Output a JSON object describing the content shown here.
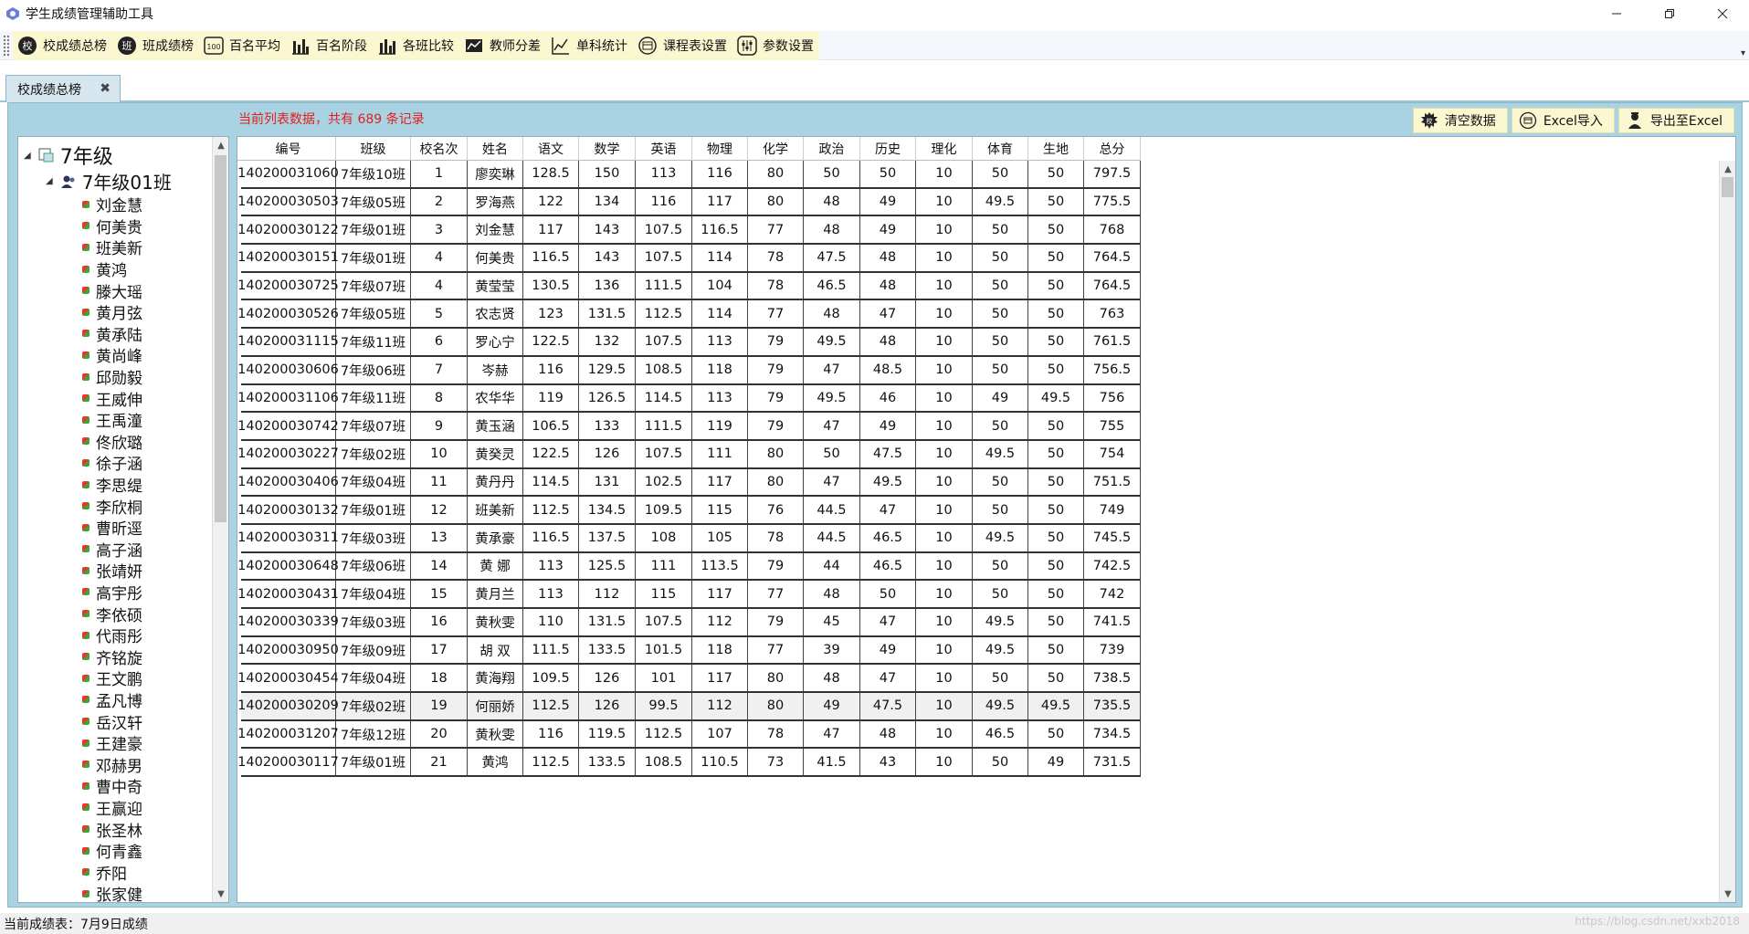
{
  "window": {
    "title": "学生成绩管理辅助工具"
  },
  "toolbar": {
    "buttons": [
      {
        "label": "校成绩总榜",
        "icon": "school-badge-icon"
      },
      {
        "label": "班成绩榜",
        "icon": "class-badge-icon"
      },
      {
        "label": "百名平均",
        "icon": "hundred-icon"
      },
      {
        "label": "百名阶段",
        "icon": "bar-chart-icon"
      },
      {
        "label": "各班比较",
        "icon": "bar-chart-icon"
      },
      {
        "label": "教师分差",
        "icon": "teacher-chart-icon"
      },
      {
        "label": "单科统计",
        "icon": "line-chart-icon"
      },
      {
        "label": "课程表设置",
        "icon": "schedule-icon"
      },
      {
        "label": "参数设置",
        "icon": "sliders-icon"
      }
    ]
  },
  "tab": {
    "label": "校成绩总榜"
  },
  "panel": {
    "info": "当前列表数据，共有 689 条记录",
    "actions": [
      {
        "label": "清空数据",
        "icon": "clear-icon"
      },
      {
        "label": "Excel导入",
        "icon": "import-icon"
      },
      {
        "label": "导出至Excel",
        "icon": "export-icon"
      }
    ]
  },
  "tree": {
    "root": "7年级",
    "class": "7年级01班",
    "students": [
      "刘金慧",
      "何美贵",
      "班美新",
      "黄鸿",
      "滕大瑶",
      "黄月弦",
      "黄承陆",
      "黄尚峰",
      "邱勋毅",
      "王威伸",
      "王禹潼",
      "佟欣璐",
      "徐子涵",
      "李思缇",
      "李欣桐",
      "曹昕逕",
      "高子涵",
      "张靖妍",
      "高宇彤",
      "李依硕",
      "代雨彤",
      "齐铭旋",
      "王文鹏",
      "孟凡博",
      "岳汉轩",
      "王建豪",
      "邓赫男",
      "曹中奇",
      "王赢迎",
      "张圣林",
      "何青鑫",
      "乔阳",
      "张家健"
    ]
  },
  "grid": {
    "columns": [
      "编号",
      "班级",
      "校名次",
      "姓名",
      "语文",
      "数学",
      "英语",
      "物理",
      "化学",
      "政治",
      "历史",
      "理化",
      "体育",
      "生地",
      "总分"
    ],
    "rows": [
      [
        "140200031060",
        "7年级10班",
        "1",
        "廖奕琳",
        "128.5",
        "150",
        "113",
        "116",
        "80",
        "50",
        "50",
        "10",
        "50",
        "50",
        "797.5"
      ],
      [
        "140200030503",
        "7年级05班",
        "2",
        "罗海燕",
        "122",
        "134",
        "116",
        "117",
        "80",
        "48",
        "49",
        "10",
        "49.5",
        "50",
        "775.5"
      ],
      [
        "140200030122",
        "7年级01班",
        "3",
        "刘金慧",
        "117",
        "143",
        "107.5",
        "116.5",
        "77",
        "48",
        "49",
        "10",
        "50",
        "50",
        "768"
      ],
      [
        "140200030151",
        "7年级01班",
        "4",
        "何美贵",
        "116.5",
        "143",
        "107.5",
        "114",
        "78",
        "47.5",
        "48",
        "10",
        "50",
        "50",
        "764.5"
      ],
      [
        "140200030725",
        "7年级07班",
        "4",
        "黄莹莹",
        "130.5",
        "136",
        "111.5",
        "104",
        "78",
        "46.5",
        "48",
        "10",
        "50",
        "50",
        "764.5"
      ],
      [
        "140200030526",
        "7年级05班",
        "5",
        "农志贤",
        "123",
        "131.5",
        "112.5",
        "114",
        "77",
        "48",
        "47",
        "10",
        "50",
        "50",
        "763"
      ],
      [
        "140200031115",
        "7年级11班",
        "6",
        "罗心宁",
        "122.5",
        "132",
        "107.5",
        "113",
        "79",
        "49.5",
        "48",
        "10",
        "50",
        "50",
        "761.5"
      ],
      [
        "140200030606",
        "7年级06班",
        "7",
        "岑赫",
        "116",
        "129.5",
        "108.5",
        "118",
        "79",
        "47",
        "48.5",
        "10",
        "50",
        "50",
        "756.5"
      ],
      [
        "140200031106",
        "7年级11班",
        "8",
        "农华华",
        "119",
        "126.5",
        "114.5",
        "113",
        "79",
        "49.5",
        "46",
        "10",
        "49",
        "49.5",
        "756"
      ],
      [
        "140200030742",
        "7年级07班",
        "9",
        "黄玉涵",
        "106.5",
        "133",
        "111.5",
        "119",
        "79",
        "47",
        "49",
        "10",
        "50",
        "50",
        "755"
      ],
      [
        "140200030227",
        "7年级02班",
        "10",
        "黄癸灵",
        "122.5",
        "126",
        "107.5",
        "111",
        "80",
        "50",
        "47.5",
        "10",
        "49.5",
        "50",
        "754"
      ],
      [
        "140200030406",
        "7年级04班",
        "11",
        "黄丹丹",
        "114.5",
        "131",
        "102.5",
        "117",
        "80",
        "47",
        "49.5",
        "10",
        "50",
        "50",
        "751.5"
      ],
      [
        "140200030132",
        "7年级01班",
        "12",
        "班美新",
        "112.5",
        "134.5",
        "109.5",
        "115",
        "76",
        "44.5",
        "47",
        "10",
        "50",
        "50",
        "749"
      ],
      [
        "140200030311",
        "7年级03班",
        "13",
        "黄承豪",
        "116.5",
        "137.5",
        "108",
        "105",
        "78",
        "44.5",
        "46.5",
        "10",
        "49.5",
        "50",
        "745.5"
      ],
      [
        "140200030648",
        "7年级06班",
        "14",
        "黄 娜",
        "113",
        "125.5",
        "111",
        "113.5",
        "79",
        "44",
        "46.5",
        "10",
        "50",
        "50",
        "742.5"
      ],
      [
        "140200030431",
        "7年级04班",
        "15",
        "黄月兰",
        "113",
        "112",
        "115",
        "117",
        "77",
        "48",
        "50",
        "10",
        "50",
        "50",
        "742"
      ],
      [
        "140200030339",
        "7年级03班",
        "16",
        "黄秋雯",
        "110",
        "131.5",
        "107.5",
        "112",
        "79",
        "45",
        "47",
        "10",
        "49.5",
        "50",
        "741.5"
      ],
      [
        "140200030950",
        "7年级09班",
        "17",
        "胡 双",
        "111.5",
        "133.5",
        "101.5",
        "118",
        "77",
        "39",
        "49",
        "10",
        "49.5",
        "50",
        "739"
      ],
      [
        "140200030454",
        "7年级04班",
        "18",
        "黄海翔",
        "109.5",
        "126",
        "101",
        "117",
        "80",
        "48",
        "47",
        "10",
        "50",
        "50",
        "738.5"
      ],
      [
        "140200030209",
        "7年级02班",
        "19",
        "何丽娇",
        "112.5",
        "126",
        "99.5",
        "112",
        "80",
        "49",
        "47.5",
        "10",
        "49.5",
        "49.5",
        "735.5"
      ],
      [
        "140200031207",
        "7年级12班",
        "20",
        "黄秋雯",
        "116",
        "119.5",
        "112.5",
        "107",
        "78",
        "47",
        "48",
        "10",
        "46.5",
        "50",
        "734.5"
      ],
      [
        "140200030117",
        "7年级01班",
        "21",
        "黄鸿",
        "112.5",
        "133.5",
        "108.5",
        "110.5",
        "73",
        "41.5",
        "43",
        "10",
        "50",
        "49",
        "731.5"
      ]
    ]
  },
  "status": {
    "text": "当前成绩表：7月9日成绩"
  },
  "watermark": "https://blog.csdn.net/xxb2018"
}
